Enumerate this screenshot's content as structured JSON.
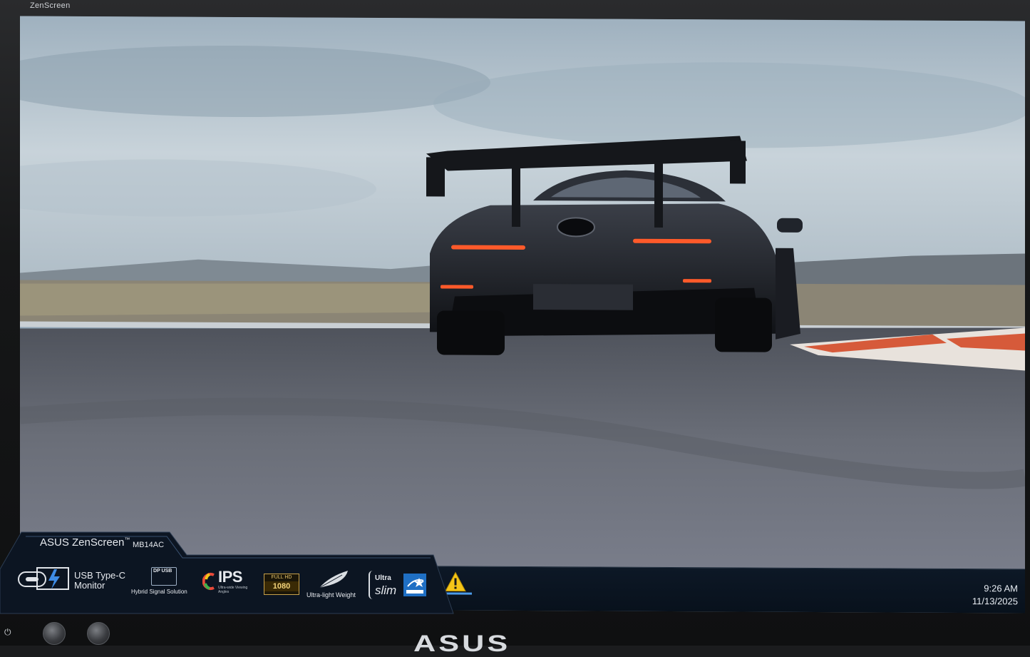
{
  "bezel": {
    "brand_label": "ZenScreen",
    "bottom_logo": "ASUS",
    "power_icon": "power-icon",
    "buttons": [
      "button-left",
      "button-right"
    ]
  },
  "desktop": {
    "wallpaper": "race car on track",
    "colors": {
      "sky": "#b7c6d1",
      "track": "#6b6f78",
      "car": "#1a1c22",
      "taillight": "#ff5a2a",
      "curb_red": "#d65a3a"
    }
  },
  "taskbar": {
    "tray_icon": "warning-icon",
    "accent": "#4c9be8",
    "clock": {
      "time": "9:26 AM",
      "date": "11/13/2025"
    }
  },
  "sticker": {
    "brand": "ASUS ZenScreen",
    "trademark": "™",
    "model": "MB14AC",
    "features": {
      "usb": "USB Type-C Monitor",
      "dp_badge": "DP USB",
      "hybrid": "Hybrid Signal Solution",
      "ips": "IPS",
      "ips_sub": "Ultra-wide Viewing Angles",
      "full_hd_top": "FULL HD",
      "full_hd_bottom": "1080",
      "ultralight": "Ultra-light Weight",
      "ultra": "Ultra",
      "slim": "slim"
    }
  }
}
